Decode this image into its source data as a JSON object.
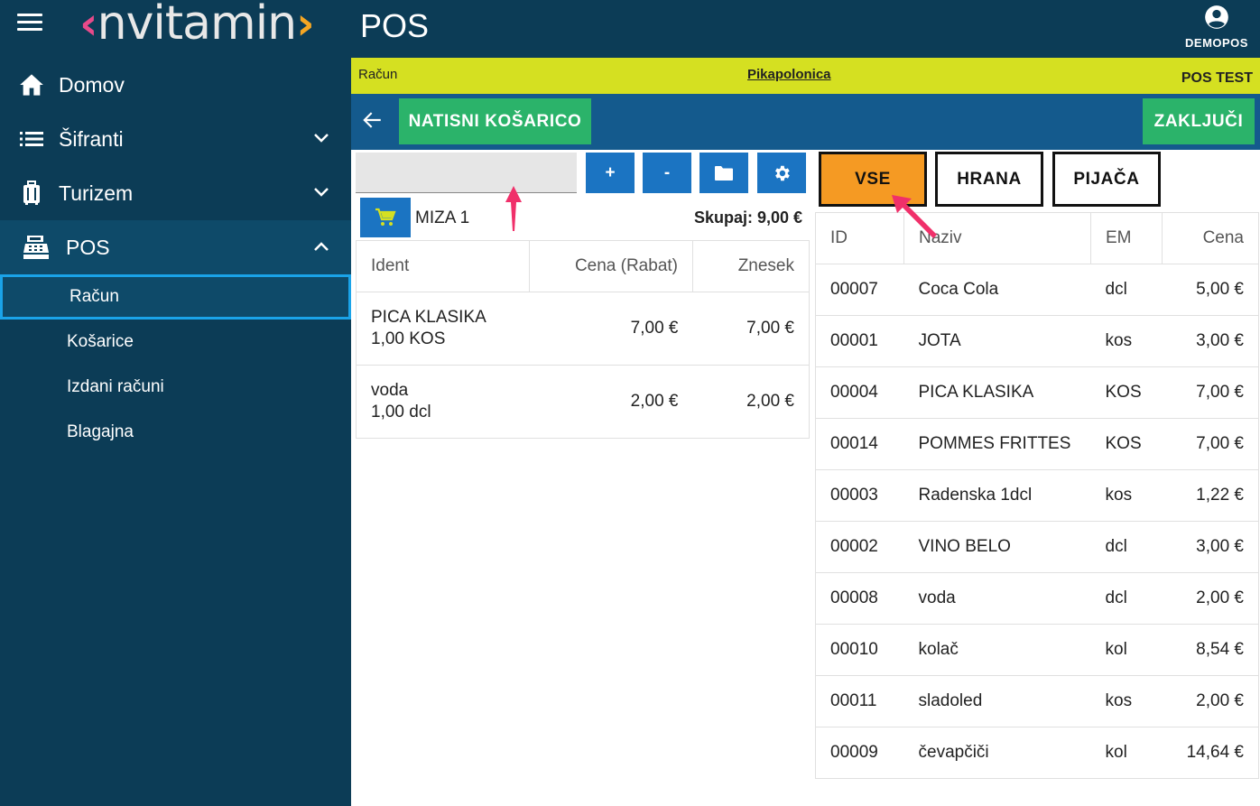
{
  "brand": {
    "logo_text": "nvitamin",
    "bracket_open": "‹",
    "bracket_close": "›"
  },
  "sidebar": {
    "items": [
      {
        "label": "Domov",
        "icon": "home-icon"
      },
      {
        "label": "Šifranti",
        "icon": "list-icon"
      },
      {
        "label": "Turizem",
        "icon": "luggage-icon"
      },
      {
        "label": "POS",
        "icon": "cash-register-icon"
      }
    ],
    "pos_subitems": [
      {
        "label": "Račun"
      },
      {
        "label": "Košarice"
      },
      {
        "label": "Izdani računi"
      },
      {
        "label": "Blagajna"
      }
    ]
  },
  "header": {
    "title": "POS",
    "user": "DEMOPOS"
  },
  "infobar": {
    "left": "Račun",
    "center": "Pikapolonica",
    "right": "POS TEST"
  },
  "actionbar": {
    "print_label": "NATISNI KOŠARICO",
    "close_label": "ZAKLJUČI"
  },
  "cart": {
    "search_value": "",
    "plus_label": "+",
    "minus_label": "-",
    "table_name": "MIZA 1",
    "total": "Skupaj: 9,00 €",
    "columns": [
      "Ident",
      "Cena (Rabat)",
      "Znesek"
    ],
    "rows": [
      {
        "name": "PICA KLASIKA",
        "qty": "1,00 KOS",
        "price": "7,00 €",
        "amount": "7,00 €"
      },
      {
        "name": "voda",
        "qty": "1,00 dcl",
        "price": "2,00 €",
        "amount": "2,00 €"
      }
    ]
  },
  "categories": [
    "VSE",
    "HRANA",
    "PIJAČA"
  ],
  "products": {
    "columns": [
      "ID",
      "Naziv",
      "EM",
      "Cena"
    ],
    "rows": [
      {
        "id": "00007",
        "name": "Coca Cola",
        "em": "dcl",
        "price": "5,00 €"
      },
      {
        "id": "00001",
        "name": "JOTA",
        "em": "kos",
        "price": "3,00 €"
      },
      {
        "id": "00004",
        "name": "PICA KLASIKA",
        "em": "KOS",
        "price": "7,00 €"
      },
      {
        "id": "00014",
        "name": "POMMES FRITTES",
        "em": "KOS",
        "price": "7,00 €"
      },
      {
        "id": "00003",
        "name": "Radenska 1dcl",
        "em": "kos",
        "price": "1,22 €"
      },
      {
        "id": "00002",
        "name": "VINO BELO",
        "em": "dcl",
        "price": "3,00 €"
      },
      {
        "id": "00008",
        "name": "voda",
        "em": "dcl",
        "price": "2,00 €"
      },
      {
        "id": "00010",
        "name": "kolač",
        "em": "kol",
        "price": "8,54 €"
      },
      {
        "id": "00011",
        "name": "sladoled",
        "em": "kos",
        "price": "2,00 €"
      },
      {
        "id": "00009",
        "name": "čevapčiči",
        "em": "kol",
        "price": "14,64 €"
      }
    ]
  },
  "colors": {
    "sidebar_bg": "#0c3c56",
    "infobar_bg": "#d5e021",
    "actionbar_bg": "#145a8d",
    "green": "#2bb36a",
    "blue": "#1b74c2",
    "active_category": "#f59a23",
    "annotation_arrow": "#f0306a"
  }
}
